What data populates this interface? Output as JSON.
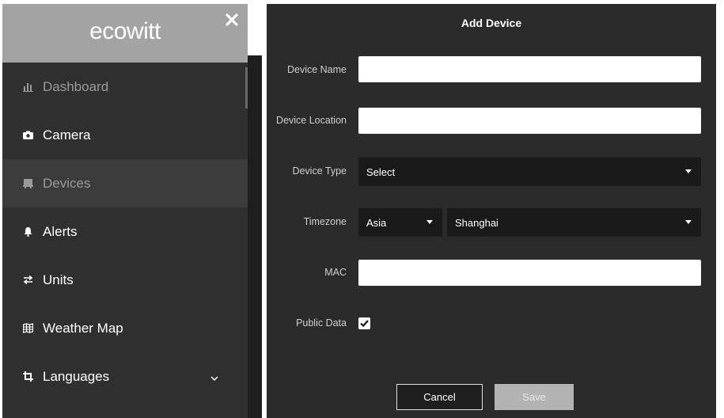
{
  "sidebar": {
    "logo": "ecowitt",
    "items": [
      {
        "label": "Dashboard",
        "icon": "bar-chart-icon"
      },
      {
        "label": "Camera",
        "icon": "camera-icon"
      },
      {
        "label": "Devices",
        "icon": "device-icon"
      },
      {
        "label": "Alerts",
        "icon": "bell-icon"
      },
      {
        "label": "Units",
        "icon": "swap-arrows-icon"
      },
      {
        "label": "Weather Map",
        "icon": "map-icon"
      },
      {
        "label": "Languages",
        "icon": "crop-icon"
      }
    ]
  },
  "dialog": {
    "title": "Add Device",
    "device_name": {
      "label": "Device Name",
      "value": ""
    },
    "device_location": {
      "label": "Device Location",
      "value": ""
    },
    "device_type": {
      "label": "Device Type",
      "selected": "Select"
    },
    "timezone": {
      "label": "Timezone",
      "region": "Asia",
      "city": "Shanghai"
    },
    "mac": {
      "label": "MAC",
      "value": ""
    },
    "public_data": {
      "label": "Public Data",
      "checked": true
    },
    "cancel_label": "Cancel",
    "save_label": "Save"
  }
}
